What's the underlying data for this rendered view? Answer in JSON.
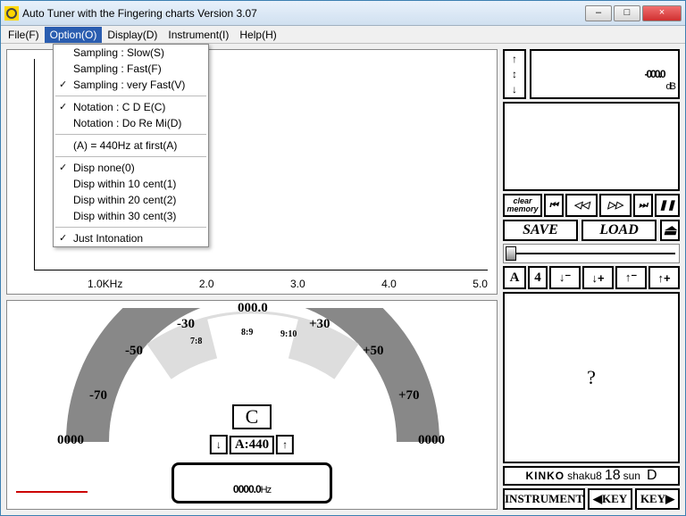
{
  "window": {
    "title": "Auto Tuner with the Fingering charts  Version 3.07",
    "minimize": "–",
    "maximize": "□",
    "close": "×"
  },
  "menu": {
    "file": "File(F)",
    "option": "Option(O)",
    "display": "Display(D)",
    "instrument": "Instrument(I)",
    "help": "Help(H)"
  },
  "option_menu": {
    "sampling_slow": "Sampling : Slow(S)",
    "sampling_fast": "Sampling : Fast(F)",
    "sampling_vfast": "Sampling : very Fast(V)",
    "notation_cde": "Notation : C D E(C)",
    "notation_drm": "Notation : Do Re Mi(D)",
    "a440": "(A) = 440Hz at first(A)",
    "disp_none": "Disp none(0)",
    "disp_10": "Disp within 10 cent(1)",
    "disp_20": "Disp within 20 cent(2)",
    "disp_30": "Disp within 30 cent(3)",
    "just_int": "Just Intonation"
  },
  "spectrum": {
    "ticks": [
      "1.0KHz",
      "2.0",
      "3.0",
      "4.0",
      "5.0"
    ]
  },
  "meter": {
    "top": "000.0",
    "labels": {
      "m30": "-30",
      "p30": "+30",
      "m50": "-50",
      "p50": "+50",
      "m70": "-70",
      "p70": "+70"
    },
    "zero_left": "0000",
    "zero_right": "0000",
    "small1": "7:8",
    "small2": "8:9",
    "small3": "9:10",
    "note": "C",
    "a440": "A:440",
    "hz_val": "0000.0",
    "hz_unit": "Hz"
  },
  "panel": {
    "display": "-000.0",
    "display_unit": "dB",
    "clear_mem": "clear\nmemory",
    "rev2": "⏮",
    "rev1": "◁◁",
    "fwd1": "▷▷",
    "fwd2": "⏭",
    "pause": "❚❚",
    "save": "SAVE",
    "load": "LOAD",
    "a_label": "A",
    "a_num": "4",
    "down2": "↓⁻",
    "down1": "↓+",
    "up1": "↑⁻",
    "up2": "↑+",
    "question": "?",
    "kinko": "KINKO",
    "kinko_sub1": "shaku8",
    "kinko_sub2": "18",
    "kinko_sub3": "sun",
    "kinko_sub4": "D",
    "instrument_btn": "INSTRUMENT",
    "key_prev": "◀KEY",
    "key_next": "KEY▶"
  }
}
